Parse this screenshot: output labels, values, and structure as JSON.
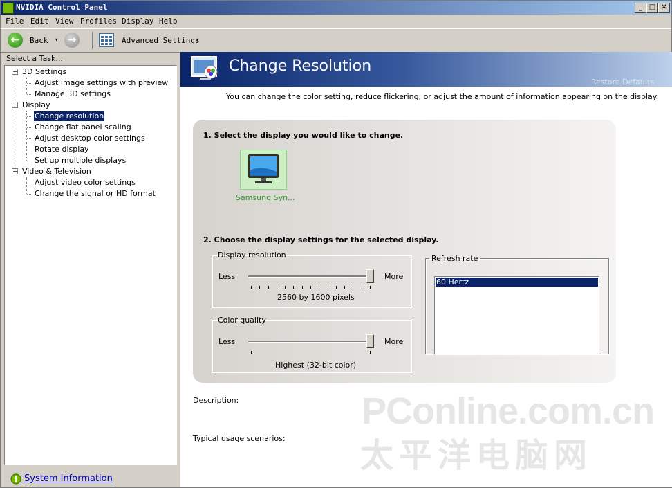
{
  "window": {
    "title": "NVIDIA Control Panel",
    "min": "_",
    "max": "□",
    "close": "✕"
  },
  "menu": [
    "File",
    "Edit",
    "View",
    "Profiles",
    "Display",
    "Help"
  ],
  "toolbar": {
    "back_label": "Back",
    "back_dropdown": "▾",
    "advanced_label": "Advanced Settings",
    "advanced_dropdown": "▾"
  },
  "left": {
    "header": "Select a Task...",
    "tree": [
      {
        "label": "3D Settings",
        "expander": "−",
        "children": [
          "Adjust image settings with preview",
          "Manage 3D settings"
        ]
      },
      {
        "label": "Display",
        "expander": "−",
        "children": [
          "Change resolution",
          "Change flat panel scaling",
          "Adjust desktop color settings",
          "Rotate display",
          "Set up multiple displays"
        ]
      },
      {
        "label": "Video & Television",
        "expander": "−",
        "children": [
          "Adjust video color settings",
          "Change the signal or HD format"
        ]
      }
    ],
    "selected": "Change resolution",
    "system_info": "System Information"
  },
  "page": {
    "title": "Change Resolution",
    "restore_defaults": "Restore Defaults",
    "intro": "You can change the color setting, reduce flickering, or adjust the amount of information appearing on the display.",
    "step1": "1. Select the display you would like to change.",
    "display_name": "Samsung Syn...",
    "step2": "2. Choose the display settings for the selected display.",
    "resolution": {
      "legend": "Display resolution",
      "less": "Less",
      "more": "More",
      "value": "2560 by 1600 pixels",
      "position": 1.0
    },
    "color": {
      "legend": "Color quality",
      "less": "Less",
      "more": "More",
      "value": "Highest (32-bit color)",
      "position": 1.0
    },
    "refresh": {
      "legend": "Refresh rate",
      "options": [
        "60 Hertz"
      ],
      "selected": "60 Hertz"
    },
    "description_label": "Description:",
    "scenarios_label": "Typical usage scenarios:"
  },
  "watermark": {
    "line1": "PConline.com.cn",
    "line2": "太平洋电脑网"
  },
  "colors": {
    "titlebar": "#0a246a",
    "selection": "#0a246a",
    "nvidia_green": "#76b900",
    "link": "#0000c0"
  }
}
